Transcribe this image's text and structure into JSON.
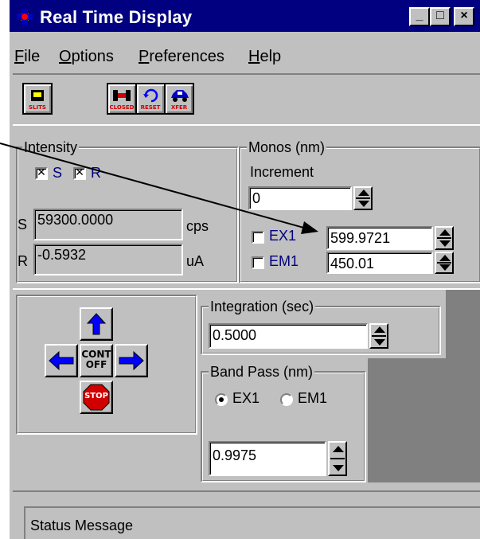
{
  "window": {
    "title": "Real Time Display",
    "minimize": "_",
    "maximize": "□",
    "close": "×"
  },
  "menu": [
    {
      "label": "File",
      "key": "F",
      "rest": "ile"
    },
    {
      "label": "Options",
      "key": "O",
      "rest": "ptions"
    },
    {
      "label": "Preferences",
      "key": "P",
      "rest": "references"
    },
    {
      "label": "Help",
      "key": "H",
      "rest": "elp"
    }
  ],
  "toolbar": {
    "slits": "SLITS",
    "closed": "CLOSED",
    "reset": "RESET",
    "xfer": "XFER"
  },
  "intensity": {
    "legend": "Intensity",
    "chk_s_label": "S",
    "chk_r_label": "R",
    "s_label": "S",
    "s_value": "59300.0000",
    "s_unit": "cps",
    "r_label": "R",
    "r_value": "-0.5932",
    "r_unit": "uA"
  },
  "monos": {
    "legend": "Monos (nm)",
    "increment_label": "Increment",
    "increment_value": "0",
    "ex1_label": "EX1",
    "ex1_value": "599.9721",
    "em1_label": "EM1",
    "em1_value": "450.01"
  },
  "controls": {
    "cont_line1": "CONT",
    "cont_line2": "OFF",
    "stop": "STOP"
  },
  "integration": {
    "legend": "Integration (sec)",
    "value": "0.5000"
  },
  "bandpass": {
    "legend": "Band Pass (nm)",
    "radio_ex1": "EX1",
    "radio_em1": "EM1",
    "selected": "EX1",
    "value": "0.9975"
  },
  "status": {
    "message": "Status Message"
  },
  "colors": {
    "title_bar": "#000080",
    "face": "#c0c0c0",
    "accent_blue": "#0000ff",
    "stop_red": "#d00000"
  }
}
